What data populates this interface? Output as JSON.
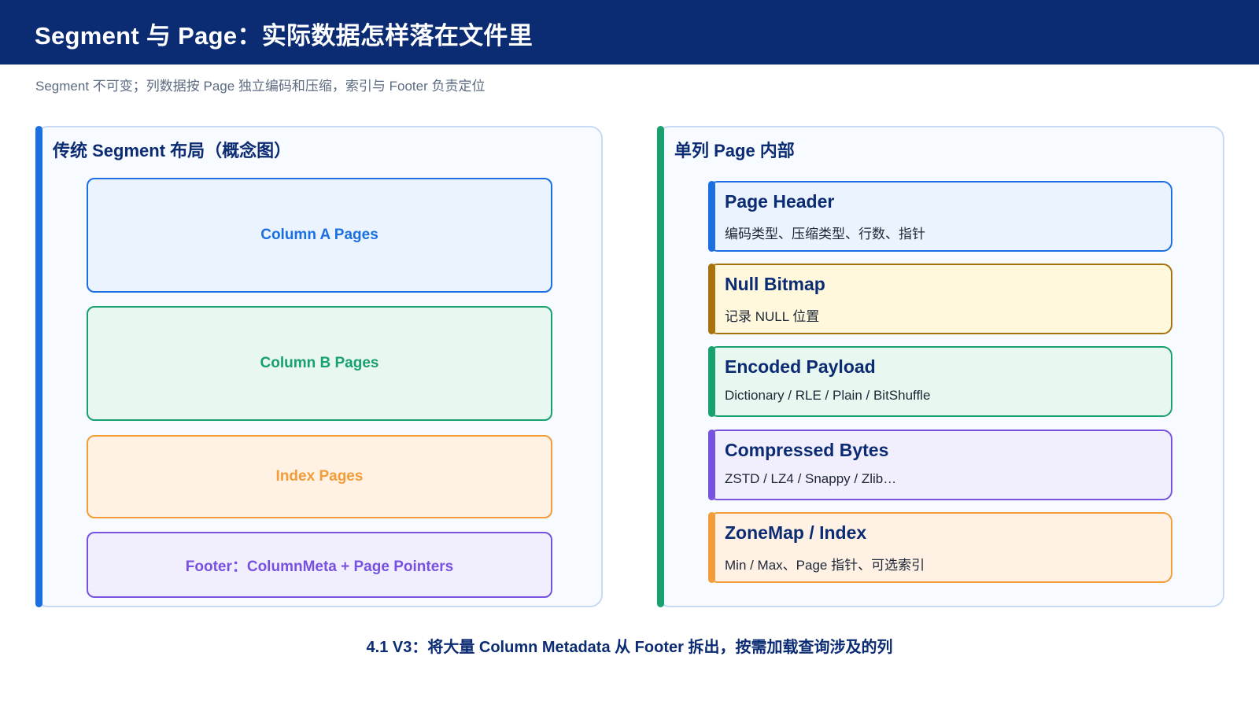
{
  "header": {
    "title": "Segment 与 Page：实际数据怎样落在文件里",
    "subtitle": "Segment 不可变；列数据按 Page 独立编码和压缩，索引与 Footer 负责定位"
  },
  "left_panel": {
    "title": "传统 Segment 布局（概念图）",
    "blocks": [
      {
        "label": "Column A Pages"
      },
      {
        "label": "Column B Pages"
      },
      {
        "label": "Index Pages"
      },
      {
        "label": "Footer：ColumnMeta + Page Pointers"
      }
    ]
  },
  "right_panel": {
    "title": "单列 Page 内部",
    "cards": [
      {
        "title": "Page Header",
        "desc": "编码类型、压缩类型、行数、指针"
      },
      {
        "title": "Null Bitmap",
        "desc": "记录 NULL 位置"
      },
      {
        "title": "Encoded Payload",
        "desc": "Dictionary / RLE / Plain / BitShuffle"
      },
      {
        "title": "Compressed Bytes",
        "desc": "ZSTD / LZ4 / Snappy / Zlib…"
      },
      {
        "title": "ZoneMap / Index",
        "desc": "Min / Max、Page 指针、可选索引"
      }
    ]
  },
  "footer": {
    "caption": "4.1 V3：将大量 Column Metadata 从 Footer 拆出，按需加载查询涉及的列"
  },
  "colors": {
    "header_bg": "#0b2b73",
    "blue": "#1c6fe0",
    "green": "#18a06e",
    "orange": "#f29d38",
    "purple": "#7752e0",
    "gold": "#a8730d"
  }
}
